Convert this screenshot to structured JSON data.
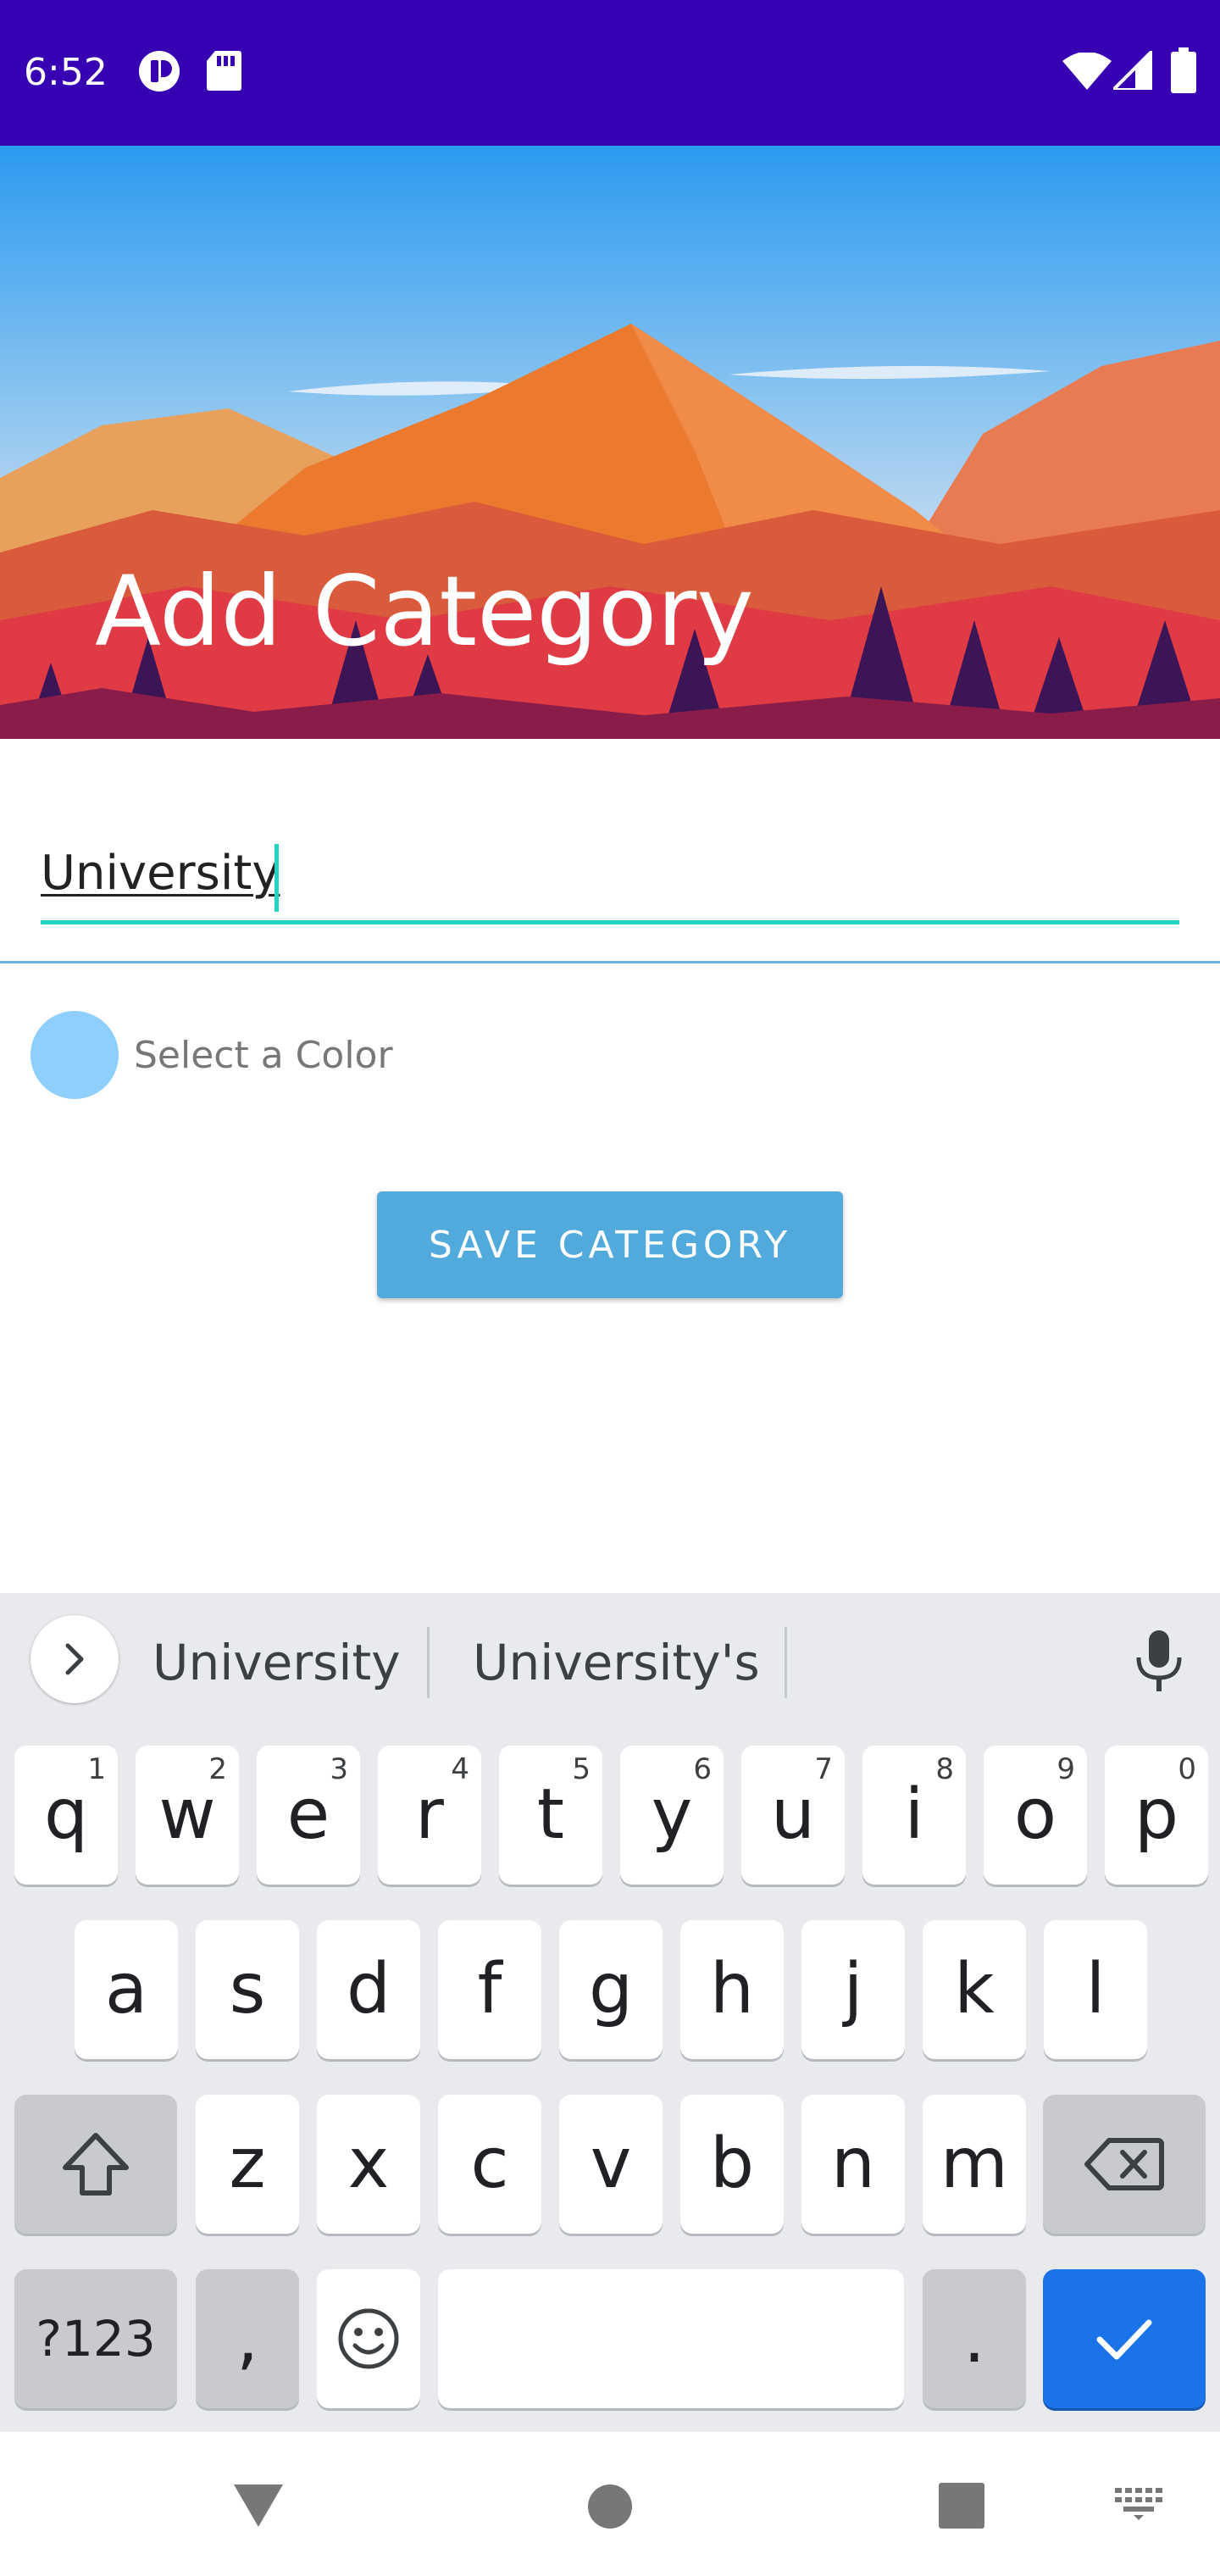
{
  "status_bar": {
    "time": "6:52",
    "icons": [
      "notification-icon",
      "sd-card-icon",
      "wifi-icon",
      "signal-icon",
      "battery-icon"
    ],
    "background": "#3700b3"
  },
  "header": {
    "title": "Add Category"
  },
  "form": {
    "name_value": "University",
    "accent_color": "#26d3c0",
    "color_label": "Select a Color",
    "selected_color": "#8ecffd",
    "save_label": "SAVE CATEGORY",
    "button_color": "#52a9dc"
  },
  "keyboard": {
    "suggestions": [
      "University",
      "University's"
    ],
    "row1": [
      {
        "key": "q",
        "hint": "1"
      },
      {
        "key": "w",
        "hint": "2"
      },
      {
        "key": "e",
        "hint": "3"
      },
      {
        "key": "r",
        "hint": "4"
      },
      {
        "key": "t",
        "hint": "5"
      },
      {
        "key": "y",
        "hint": "6"
      },
      {
        "key": "u",
        "hint": "7"
      },
      {
        "key": "i",
        "hint": "8"
      },
      {
        "key": "o",
        "hint": "9"
      },
      {
        "key": "p",
        "hint": "0"
      }
    ],
    "row2": [
      "a",
      "s",
      "d",
      "f",
      "g",
      "h",
      "j",
      "k",
      "l"
    ],
    "row3": [
      "z",
      "x",
      "c",
      "v",
      "b",
      "n",
      "m"
    ],
    "symbols_label": "?123",
    "comma_label": ",",
    "period_label": ".",
    "done_color": "#1a73e8"
  },
  "nav_bar": {
    "icons": [
      "back-icon",
      "home-icon",
      "recents-icon",
      "keyboard-switch-icon"
    ]
  }
}
